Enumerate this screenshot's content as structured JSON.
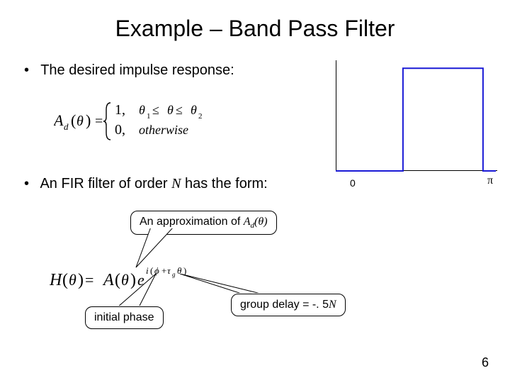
{
  "title": "Example – Band Pass Filter",
  "bullets": {
    "b1": "The desired impulse response:",
    "b2_pre": "An FIR filter of order ",
    "b2_N": "N",
    "b2_post": " has the form:"
  },
  "piecewise": {
    "lhs_A": "A",
    "lhs_dsub": "d",
    "lhs_theta": "θ",
    "row1_val": "1,",
    "row1_cond_t1": "θ",
    "row1_cond_s1": "1",
    "row1_cond_le1": " ≤ ",
    "row1_cond_mid": "θ",
    "row1_cond_le2": " ≤ ",
    "row1_cond_t2": "θ",
    "row1_cond_s2": "2",
    "row2_val": "0,",
    "row2_cond": "otherwise"
  },
  "formula2": {
    "H": "H",
    "theta1": "θ",
    "eq": " = ",
    "A": "A",
    "theta2": "θ",
    "e": "e",
    "i": "i",
    "lp": "(",
    "phi": "ϕ",
    "plus": "+",
    "tau": "τ",
    "g": "g",
    "theta3": "θ",
    "rp": ")"
  },
  "annot": {
    "approx_pre": "An approximation of ",
    "approx_A": "A",
    "approx_d": "d",
    "approx_lp": "(",
    "approx_th": "θ",
    "approx_rp": ")",
    "phase": "initial phase",
    "group_pre": "group delay = -. 5",
    "group_N": "N"
  },
  "chart_data": {
    "type": "line",
    "x": [
      0,
      0.42,
      0.42,
      0.92,
      0.92,
      1.0
    ],
    "y": [
      0,
      0,
      1,
      1,
      0,
      0
    ],
    "xlim": [
      0,
      1
    ],
    "ylim": [
      0,
      1.05
    ],
    "xticks": {
      "0": "0",
      "1": "π"
    },
    "stroke": "#1a1ad6"
  },
  "axis": {
    "zero": "0",
    "pi": "π"
  },
  "pagenum": "6"
}
